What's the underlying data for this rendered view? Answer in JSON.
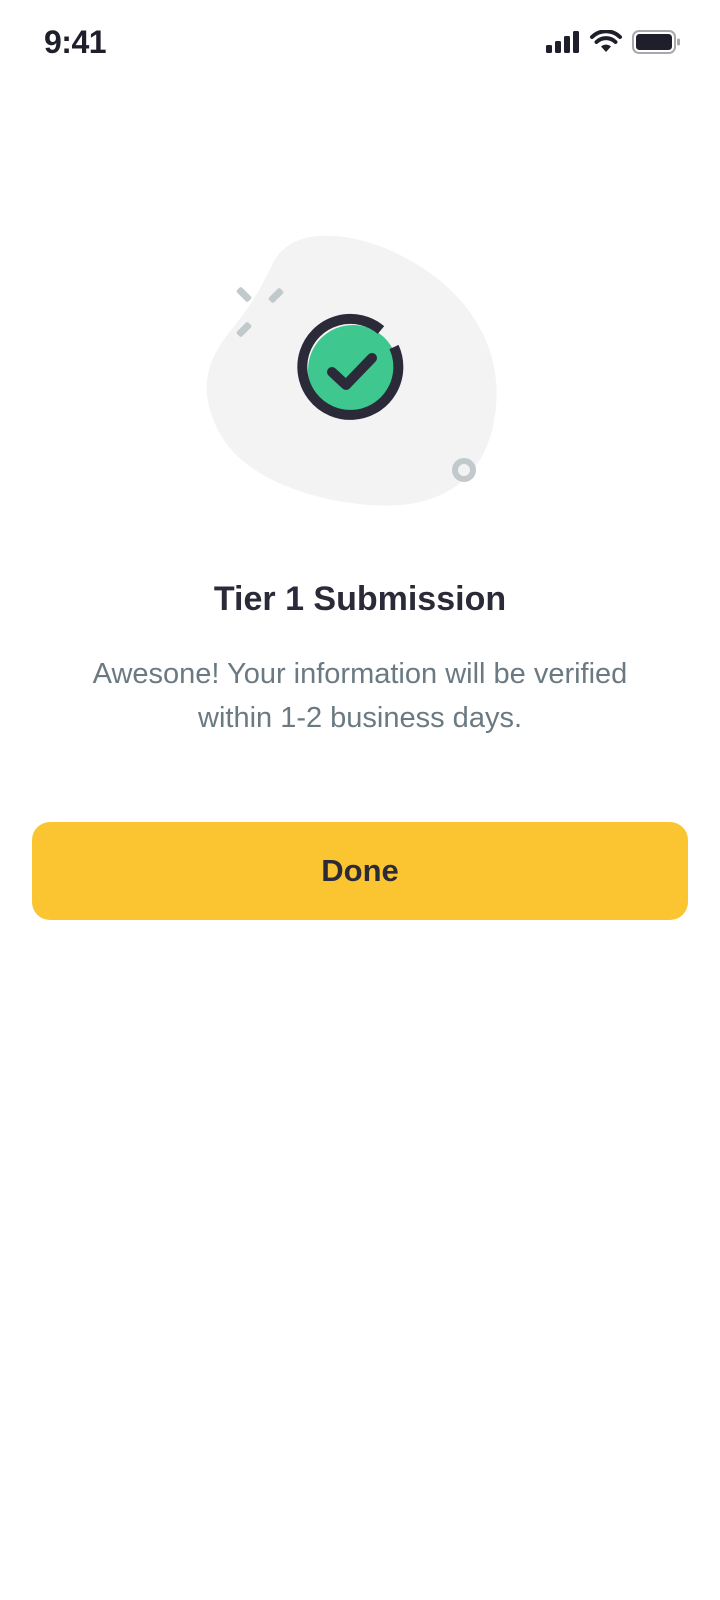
{
  "status_bar": {
    "time": "9:41",
    "icons": [
      "signal-icon",
      "wifi-icon",
      "battery-icon"
    ]
  },
  "illustration": {
    "icon": "check-circle-icon",
    "colors": {
      "blob": "#f3f3f3",
      "accent_green": "#3ec78f",
      "dark_green": "#2fa777",
      "ring": "#2b2a38",
      "sparkle": "#c2c9cc"
    }
  },
  "content": {
    "title": "Tier 1 Submission",
    "message_line1": "Awesone! Your information will be verified",
    "message_line2": "within 1-2 business days."
  },
  "actions": {
    "done_label": "Done"
  },
  "colors": {
    "primary_button": "#fbc531",
    "title_text": "#2b2a38",
    "body_text": "#6b7a82"
  }
}
